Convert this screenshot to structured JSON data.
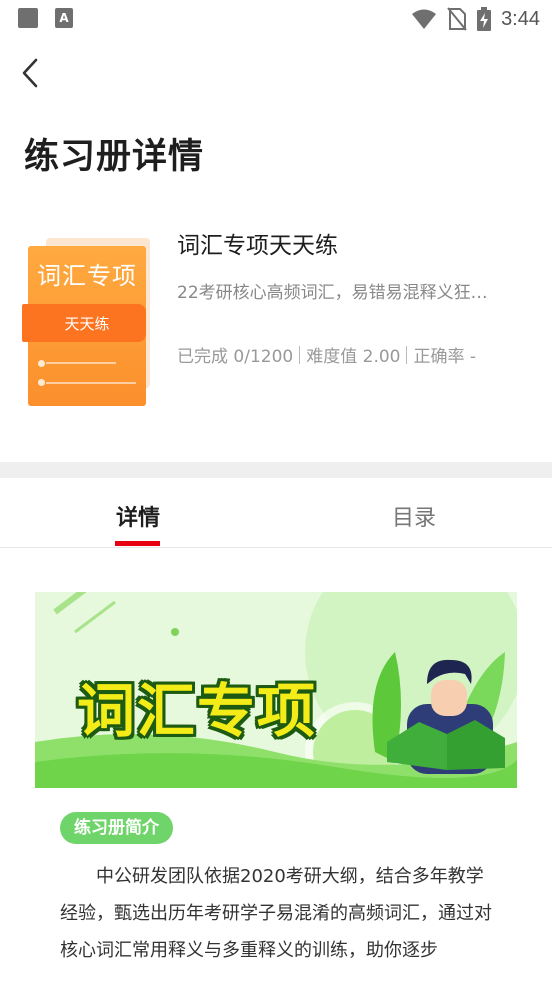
{
  "status_bar": {
    "time": "3:44",
    "icons": [
      "square-icon",
      "a-icon",
      "wifi-icon",
      "no-sim-icon",
      "battery-charging-icon"
    ]
  },
  "header": {
    "title": "练习册详情",
    "back_icon": "chevron-left-icon"
  },
  "book": {
    "cover_title": "词汇专项",
    "cover_band": "天天练",
    "name": "词汇专项天天练",
    "description": "22考研核心高频词汇，易错易混释义狂…",
    "stats": {
      "completed": "已完成 0/1200",
      "difficulty": "难度值 2.00",
      "accuracy": "正确率 -"
    }
  },
  "tabs": [
    {
      "label": "详情",
      "active": true
    },
    {
      "label": "目录",
      "active": false
    }
  ],
  "banner": {
    "title": "词汇专项"
  },
  "intro": {
    "tag": "练习册简介",
    "text": "中公研发团队依据2020考研大纲，结合多年教学经验，甄选出历年考研学子易混淆的高频词汇，通过对核心词汇常用释义与多重释义的训练，助你逐步"
  },
  "colors": {
    "accent_red": "#e60012",
    "cover_orange": "#fb8f2c",
    "intro_green": "#6fd56a"
  }
}
